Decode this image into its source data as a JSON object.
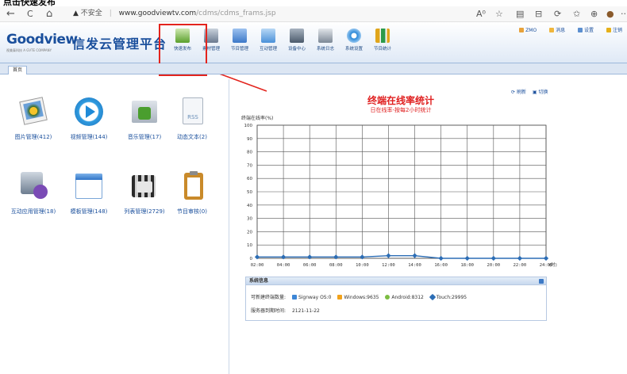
{
  "caption": "点击快速发布",
  "browser": {
    "back": "←",
    "reload": "C",
    "home": "⌂",
    "insecure_label": "不安全",
    "host": "www.goodviewtv.com",
    "path": "/cdms/cdms_frams.jsp",
    "right_icons": [
      "A⁰",
      "☆",
      "▤",
      "⊟",
      "⟳",
      "✩",
      "⊕",
      "●",
      "···"
    ]
  },
  "header": {
    "logo": "Goodview",
    "logo_sub": "视美泰科技 A GVTE COMPANY",
    "platform": "信发云管理平台",
    "tools": [
      {
        "label": "快速发布",
        "color": "#5aa02c"
      },
      {
        "label": "素材管理",
        "color": "#6b7a8f"
      },
      {
        "label": "节目管理",
        "color": "#3c78c8"
      },
      {
        "label": "互动管理",
        "color": "#4a90d9"
      },
      {
        "label": "设备中心",
        "color": "#4b5a6b"
      },
      {
        "label": "系统日志",
        "color": "#7c8896"
      },
      {
        "label": "系统设置",
        "color": "#2a88d8"
      },
      {
        "label": "节目统计",
        "color": "#e0a51b"
      }
    ],
    "top_links": [
      {
        "label": "ZMO",
        "color": "#e8a23a"
      },
      {
        "label": "消息",
        "color": "#f0b63c"
      },
      {
        "label": "设置",
        "color": "#5b8fd0"
      },
      {
        "label": "注销",
        "color": "#e6b019"
      }
    ]
  },
  "tabs": {
    "home": "首页"
  },
  "grid": [
    {
      "label": "图片管理(412)",
      "icon": "picture-icon"
    },
    {
      "label": "视频管理(144)",
      "icon": "video-play-icon"
    },
    {
      "label": "音乐管理(17)",
      "icon": "music-folder-icon"
    },
    {
      "label": "动态文本(2)",
      "icon": "rss-doc-icon"
    },
    {
      "label": "互动应用管理(18)",
      "icon": "interactive-app-icon"
    },
    {
      "label": "模板管理(148)",
      "icon": "template-window-icon"
    },
    {
      "label": "列表管理(2729)",
      "icon": "playlist-film-icon"
    },
    {
      "label": "节目审核(0)",
      "icon": "review-clipboard-icon"
    }
  ],
  "right": {
    "refresh": "刷新",
    "switch": "切换",
    "title": "终端在线率统计",
    "subtitle": "日在线率-按每2小时统计"
  },
  "chart_data": {
    "type": "line",
    "ylabel": "终端在线率(%)",
    "xlabel": "(时)",
    "ylim": [
      0,
      100
    ],
    "yticks": [
      0,
      10,
      20,
      30,
      40,
      50,
      60,
      70,
      80,
      90,
      100
    ],
    "categories": [
      "02:00",
      "04:00",
      "06:00",
      "08:00",
      "10:00",
      "12:00",
      "14:00",
      "16:00",
      "18:00",
      "20:00",
      "22:00",
      "24:00"
    ],
    "values": [
      1,
      1,
      1,
      1,
      1,
      2,
      2,
      0,
      0,
      0,
      0,
      0
    ],
    "line_color": "#2c6db5",
    "grid": true
  },
  "system": {
    "header": "系统信息",
    "terminal_label": "可新建终端数量:",
    "os_counts": [
      {
        "label": "Signway OS:0",
        "color": "#3d86d6"
      },
      {
        "label": "Windows:9635",
        "color": "#f2a21a"
      },
      {
        "label": "Android:8312",
        "color": "#7cbd42"
      },
      {
        "label": "Touch:29995",
        "color": "#2c6db5"
      }
    ],
    "expiry_label": "服务器到期时间:",
    "expiry_date": "2121-11-22"
  }
}
